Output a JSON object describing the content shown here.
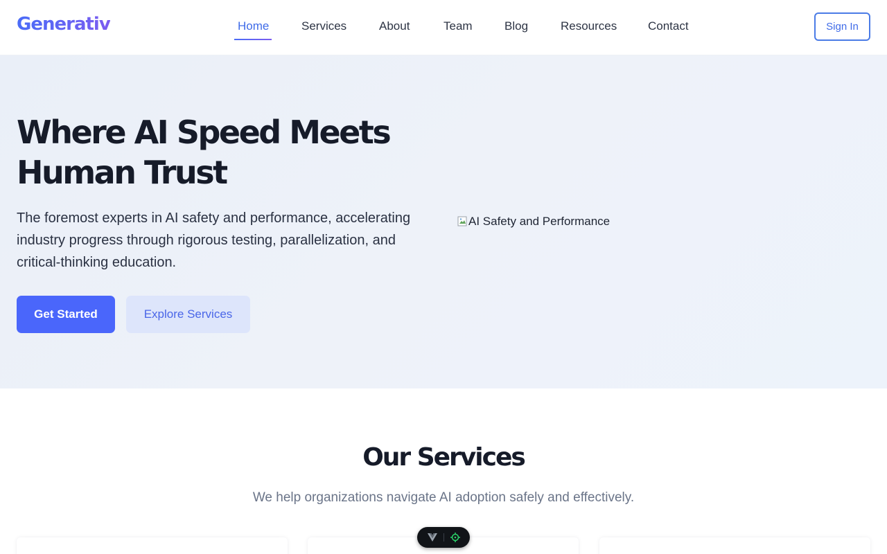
{
  "brand": {
    "name": "Generativ"
  },
  "nav": {
    "items": [
      {
        "label": "Home",
        "active": true
      },
      {
        "label": "Services"
      },
      {
        "label": "About"
      },
      {
        "label": "Team"
      },
      {
        "label": "Blog"
      },
      {
        "label": "Resources"
      },
      {
        "label": "Contact"
      }
    ],
    "sign_in": "Sign In"
  },
  "hero": {
    "title_line1": "Where AI Speed Meets",
    "title_line2": "Human Trust",
    "subtitle": "The foremost experts in AI safety and performance, accelerating industry progress through rigorous testing, parallelization, and critical-thinking education.",
    "primary_cta": "Get Started",
    "secondary_cta": "Explore Services",
    "image_alt": "AI Safety and Performance"
  },
  "services": {
    "title": "Our Services",
    "subtitle": "We help organizations navigate AI adoption safely and effectively."
  },
  "colors": {
    "accent": "#4a66fb",
    "brand_gradient_start": "#4a6cf7",
    "brand_gradient_end": "#7b5cf0",
    "hero_background": "#edf1f9",
    "heading": "#161b29"
  },
  "icons": {
    "broken_image": "broken-image-icon",
    "devtools_logo": "vue-logo-icon",
    "devtools_inspect": "crosshair-icon"
  }
}
